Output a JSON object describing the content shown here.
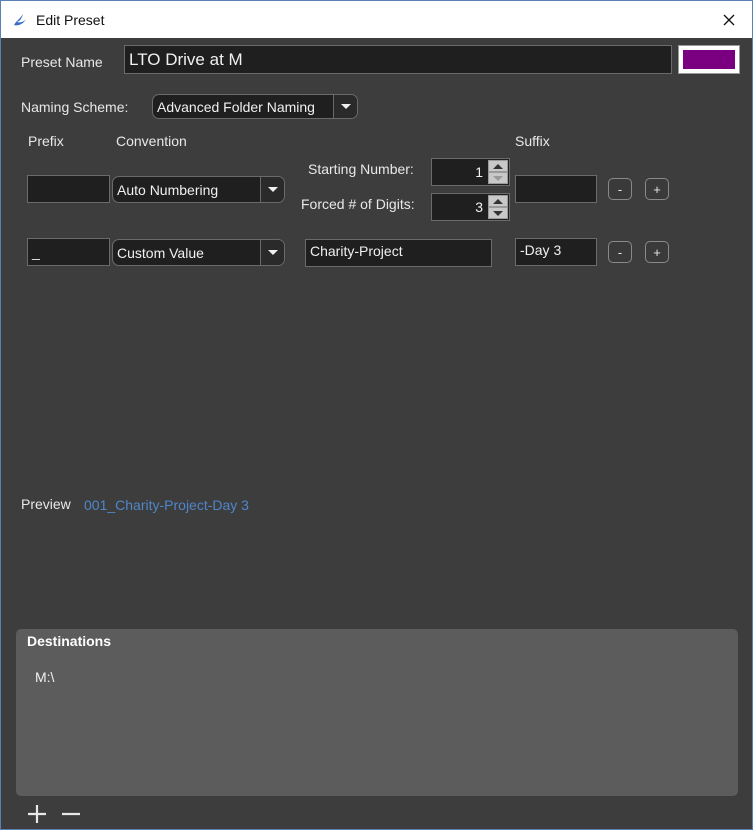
{
  "window": {
    "title": "Edit Preset"
  },
  "preset": {
    "name_label": "Preset Name",
    "name_value": "LTO Drive at M",
    "color": "#7a0081"
  },
  "naming": {
    "label": "Naming Scheme:",
    "value": "Advanced Folder Naming"
  },
  "columns": {
    "prefix": "Prefix",
    "convention": "Convention",
    "suffix": "Suffix"
  },
  "rows": [
    {
      "prefix": "",
      "convention": "Auto Numbering",
      "starting_label": "Starting Number:",
      "starting_value": "1",
      "digits_label": "Forced # of Digits:",
      "digits_value": "3",
      "suffix": "",
      "remove_label": "-",
      "add_label": "+"
    },
    {
      "prefix": "_",
      "convention": "Custom Value",
      "custom_value": "Charity-Project",
      "suffix": "-Day 3",
      "remove_label": "-",
      "add_label": "+"
    }
  ],
  "preview": {
    "label": "Preview",
    "value": "001_Charity-Project-Day 3",
    "color": "#4f86c9"
  },
  "destinations": {
    "title": "Destinations",
    "items": [
      "M:\\"
    ]
  }
}
